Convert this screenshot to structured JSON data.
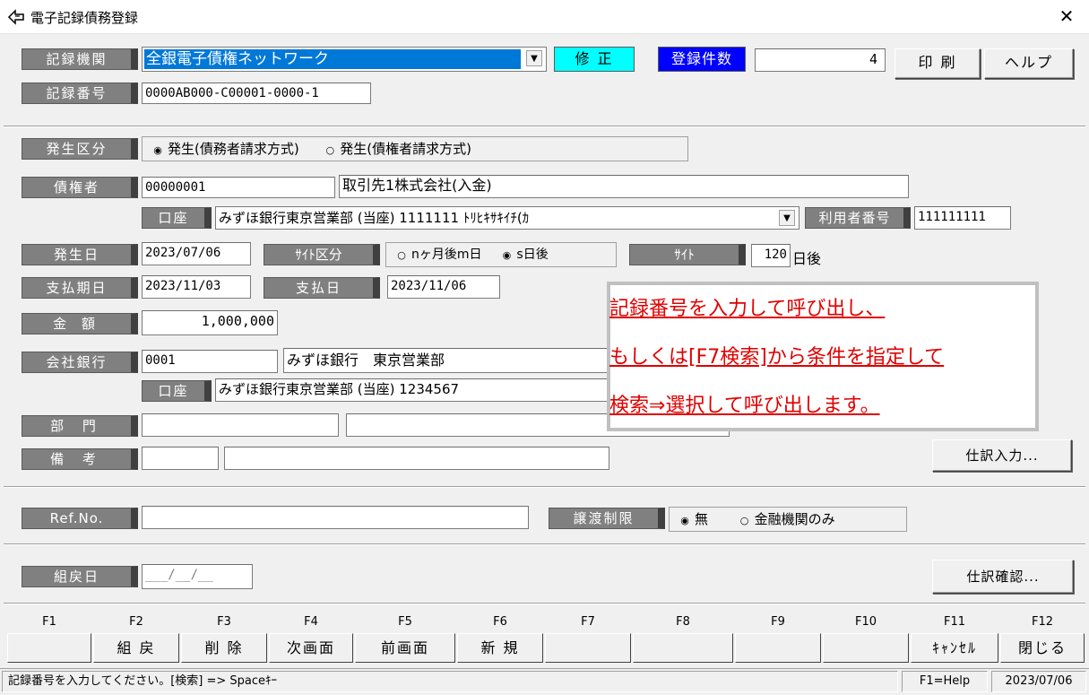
{
  "window": {
    "title": "電子記録債務登録"
  },
  "header": {
    "kiroku_kikan_label": "記録機関",
    "kiroku_kikan_value": "全銀電子債権ネットワーク",
    "mode": "修 正",
    "count_label": "登録件数",
    "count_value": "4",
    "print_btn": "印 刷",
    "help_btn": "ヘルプ",
    "kiroku_bango_label": "記録番号",
    "kiroku_bango_value": "0000AB000-C00001-0000-1"
  },
  "form": {
    "hassei_kubun_label": "発生区分",
    "hassei_opt1": "発生(債務者請求方式)",
    "hassei_opt2": "発生(債権者請求方式)",
    "saikensha_label": "債権者",
    "saikensha_code": "00000001",
    "saikensha_name": "取引先1株式会社(入金)",
    "koza_label": "口座",
    "koza_value": "みずほ銀行東京営業部 (当座) 1111111 ﾄﾘﾋｷｻｷｲﾁ(ｶ",
    "riyousha_label": "利用者番号",
    "riyousha_value": "111111111",
    "hassei_bi_label": "発生日",
    "hassei_bi_value": "2023/07/06",
    "site_kubun_label": "ｻｲﾄ区分",
    "site_opt1": "nヶ月後m日",
    "site_opt2": "s日後",
    "site_label": "ｻｲﾄ",
    "site_value": "120",
    "site_unit": "日後",
    "shiharai_kijitsu_label": "支払期日",
    "shiharai_kijitsu_value": "2023/11/03",
    "shiharai_bi_label": "支払日",
    "shiharai_bi_value": "2023/11/06",
    "kingaku_label": "金 額",
    "kingaku_value": "1,000,000",
    "kaisha_ginko_label": "会社銀行",
    "kaisha_ginko_code": "0001",
    "kaisha_ginko_name": "みずほ銀行　東京営業部",
    "kaisha_koza_label": "口座",
    "kaisha_koza_value": "みずほ銀行東京営業部 (当座) 1234567",
    "bumon_label": "部 門",
    "bumon_code": "",
    "bumon_name": "",
    "biko_label": "備 考",
    "biko_code": "",
    "biko_text": "",
    "shiwake_input_btn": "仕訳入力...",
    "refno_label": "Ref.No.",
    "refno_value": "",
    "joto_label": "譲渡制限",
    "joto_opt1": "無",
    "joto_opt2": "金融機関のみ",
    "kumimodoshi_label": "組戻日",
    "kumimodoshi_value": "___/__/__",
    "shiwake_confirm_btn": "仕訳確認..."
  },
  "note": {
    "line1": "記録番号を入力して呼び出し、",
    "line2": "もしくは[F7検索]から条件を指定して",
    "line3": "検索⇒選択して呼び出します。"
  },
  "fkeys": [
    {
      "key": "F1",
      "label": ""
    },
    {
      "key": "F2",
      "label": "組 戻"
    },
    {
      "key": "F3",
      "label": "削 除"
    },
    {
      "key": "F4",
      "label": "次画面"
    },
    {
      "key": "F5",
      "label": "前画面"
    },
    {
      "key": "F6",
      "label": "新 規"
    },
    {
      "key": "F7",
      "label": ""
    },
    {
      "key": "F8",
      "label": ""
    },
    {
      "key": "F9",
      "label": ""
    },
    {
      "key": "F10",
      "label": ""
    },
    {
      "key": "F11",
      "label": "ｷｬﾝｾﾙ"
    },
    {
      "key": "F12",
      "label": "閉じる"
    }
  ],
  "status": {
    "message": "記録番号を入力してください。[検索] => Spaceｷｰ",
    "help": "F1=Help",
    "date": "2023/07/06"
  },
  "colors": {
    "mode_bg": "#00ffff",
    "count_bg": "#0000ff",
    "label_bg": "#808080",
    "note_text": "#e00000"
  }
}
